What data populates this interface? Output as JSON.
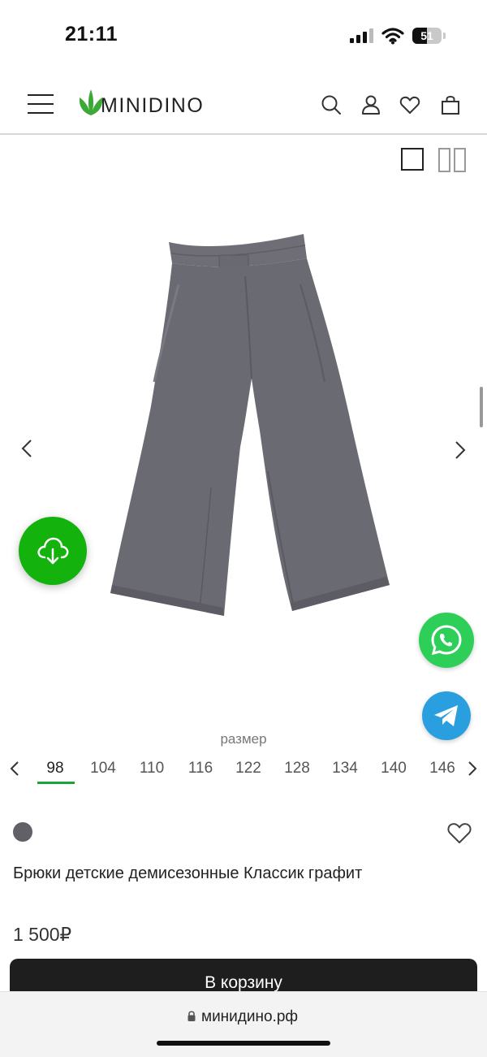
{
  "status_bar": {
    "time": "21:11",
    "battery_percent": "51",
    "battery_level": 0.51
  },
  "header": {
    "logo_text": "MINIDINO",
    "logo_color": "#3aa935",
    "icons": [
      "menu-icon",
      "search-icon",
      "user-icon",
      "heart-icon",
      "bag-icon"
    ]
  },
  "gallery": {
    "view_modes": [
      "single-view-icon",
      "double-view-icon"
    ],
    "product_color": "#6a6a73"
  },
  "floating": {
    "download_color": "#14b20d",
    "whatsapp_color": "#2ecf58",
    "telegram_color": "#2a9fe0"
  },
  "sizes": {
    "label": "размер",
    "items": [
      "98",
      "104",
      "110",
      "116",
      "122",
      "128",
      "134",
      "140",
      "146"
    ],
    "selected": "98"
  },
  "product": {
    "color_swatch": "#606066",
    "title": "Брюки детские демисезонные Классик графит",
    "price": "1 500₽",
    "cart_button": "В корзину"
  },
  "browser": {
    "url": "минидино.рф"
  }
}
